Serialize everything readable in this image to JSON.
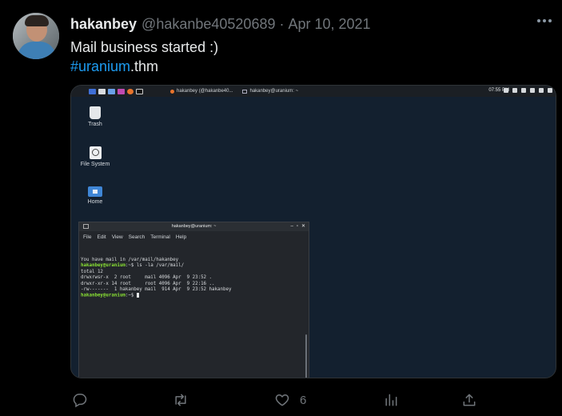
{
  "tweet": {
    "display_name": "hakanbey",
    "handle": "@hakanbe40520689",
    "separator": "·",
    "date": "Apr 10, 2021",
    "text": "Mail business started :)",
    "hashtag": "#uranium",
    "hashtag_suffix": ".thm"
  },
  "screenshot": {
    "taskbar": {
      "window_1": "hakanbey (@hakanbe40...",
      "window_2": "hakanbey@uranium: ~",
      "time": "07:55 PM"
    },
    "desktop_icons": [
      {
        "label": "Trash",
        "icon": "trash-icon"
      },
      {
        "label": "File System",
        "icon": "drive-icon"
      },
      {
        "label": "Home",
        "icon": "home-folder-icon"
      }
    ],
    "terminal": {
      "title": "hakanbey@uranium: ~",
      "controls": [
        "–",
        "▫",
        "✕"
      ],
      "menu": [
        "File",
        "Edit",
        "View",
        "Search",
        "Terminal",
        "Help"
      ],
      "lines": [
        {
          "prompt": "",
          "text": "You have mail in /var/mail/hakanbey"
        },
        {
          "prompt": "hakanbey@uranium",
          "text": ":~$ ls -la /var/mail/"
        },
        {
          "prompt": "",
          "text": "total 12"
        },
        {
          "prompt": "",
          "text": "drwxrwsr-x  2 root     mail 4096 Apr  9 23:52 ."
        },
        {
          "prompt": "",
          "text": "drwxr-xr-x 14 root     root 4096 Apr  9 22:16 .."
        },
        {
          "prompt": "",
          "text": "-rw-------  1 hakanbey mail  914 Apr  9 23:52 hakanbey"
        },
        {
          "prompt": "hakanbey@uranium",
          "text": ":~$ "
        }
      ]
    }
  },
  "actions": {
    "like_count": "6"
  },
  "colors": {
    "background": "#000000",
    "text": "#e7e9ea",
    "muted": "#71767b",
    "link": "#1d9bf0",
    "desktop": "#13202f",
    "prompt": "#8ae234"
  }
}
